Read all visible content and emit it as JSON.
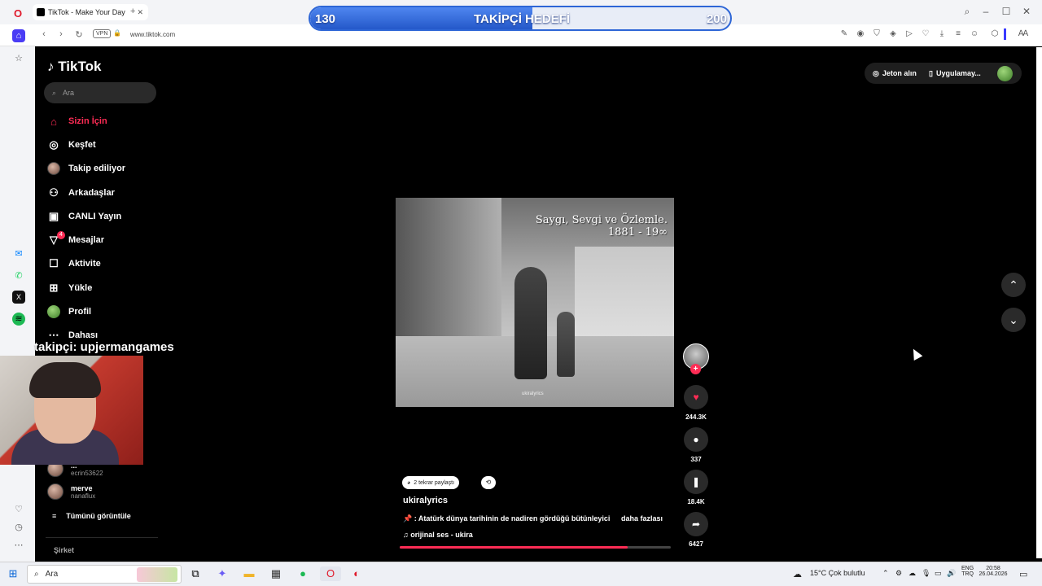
{
  "browser": {
    "tab_title": "TikTok - Make Your Day",
    "url": "www.tiktok.com",
    "vpn_label": "VPN"
  },
  "goal": {
    "title": "TAKİPÇİ HEDEFİ",
    "current": "130",
    "target": "200",
    "progress_fraction": 0.53
  },
  "tiktok": {
    "logo": "TikTok",
    "search_placeholder": "Ara",
    "top_actions": {
      "coins": "Jeton alın",
      "app": "Uygulamay..."
    },
    "nav": [
      {
        "label": "Sizin İçin",
        "icon": "home-icon",
        "active": true
      },
      {
        "label": "Keşfet",
        "icon": "compass-icon"
      },
      {
        "label": "Takip ediliyor",
        "icon": "following-avatar-icon"
      },
      {
        "label": "Arkadaşlar",
        "icon": "friends-icon"
      },
      {
        "label": "CANLI Yayın",
        "icon": "live-icon"
      },
      {
        "label": "Mesajlar",
        "icon": "messages-icon",
        "badge": "4"
      },
      {
        "label": "Aktivite",
        "icon": "activity-icon"
      },
      {
        "label": "Yükle",
        "icon": "upload-icon"
      },
      {
        "label": "Profil",
        "icon": "profile-avatar-icon"
      },
      {
        "label": "Dahası",
        "icon": "more-icon"
      }
    ],
    "following": [
      {
        "name": "...",
        "handle": "ecrin53622"
      },
      {
        "name": "merve",
        "handle": "nanaflux"
      }
    ],
    "see_all": "Tümünü görüntüle",
    "company": "Şirket",
    "overlay_text": "takipçi: upjermangames",
    "video": {
      "title_line1": "Saygı, Sevgi ve Özlemle.",
      "title_line2": "1881 - 19∞",
      "watermark": "ukiralyrics",
      "author": "ukiralyrics",
      "repost_label": "2 tekrar paylaştı",
      "description": ": Atatürk dünya tarihinin de nadiren gördüğü bütünleyici",
      "more": "daha fazlası",
      "music": "orijinal ses - ukira",
      "progress_fraction": 0.84,
      "likes": "244.3K",
      "comments": "337",
      "saves": "18.4K",
      "shares": "6427"
    }
  },
  "taskbar": {
    "search": "Ara",
    "weather": "15°C  Çok bulutlu",
    "lang1": "ENG",
    "lang2": "TRQ",
    "time": "20:58",
    "date": "26.04.2026"
  }
}
